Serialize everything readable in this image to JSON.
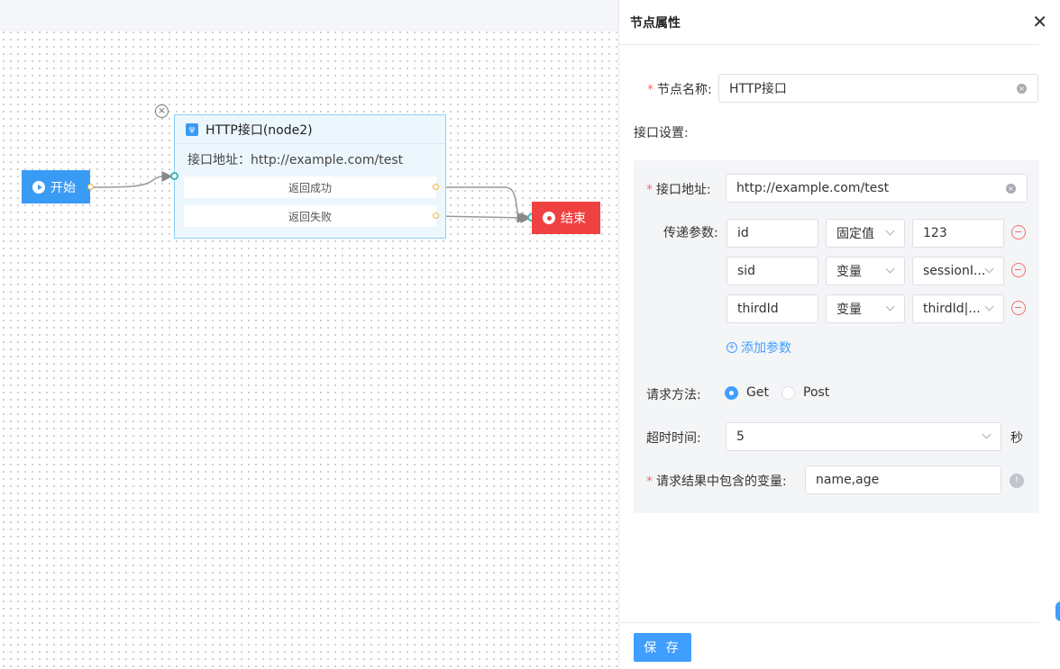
{
  "canvas": {
    "start_label": "开始",
    "end_label": "结束",
    "http_node": {
      "title": "HTTP接口(node2)",
      "url_line": "接口地址：http://example.com/test",
      "success_label": "返回成功",
      "fail_label": "返回失败"
    }
  },
  "panel": {
    "title": "节点属性",
    "node_name_label": "节点名称:",
    "node_name_value": "HTTP接口",
    "interface_settings_label": "接口设置:",
    "url_label": "接口地址:",
    "url_value": "http://example.com/test",
    "params_label": "传递参数:",
    "params": [
      {
        "name": "id",
        "type": "固定值",
        "value": "123",
        "value_is_select": false
      },
      {
        "name": "sid",
        "type": "变量",
        "value": "sessionI...",
        "value_is_select": true
      },
      {
        "name": "thirdId",
        "type": "变量",
        "value": "thirdId|...",
        "value_is_select": true
      }
    ],
    "add_param_label": "添加参数",
    "method_label": "请求方法:",
    "methods": [
      {
        "label": "Get",
        "selected": true
      },
      {
        "label": "Post",
        "selected": false
      }
    ],
    "timeout_label": "超时时间:",
    "timeout_value": "5",
    "timeout_unit": "秒",
    "result_vars_label": "请求结果中包含的变量:",
    "result_vars_value": "name,age",
    "save_label": "保 存"
  },
  "colors": {
    "primary": "#409eff",
    "start_node": "#3a9bf5",
    "end_node": "#f04142",
    "danger": "#f56c6c"
  }
}
